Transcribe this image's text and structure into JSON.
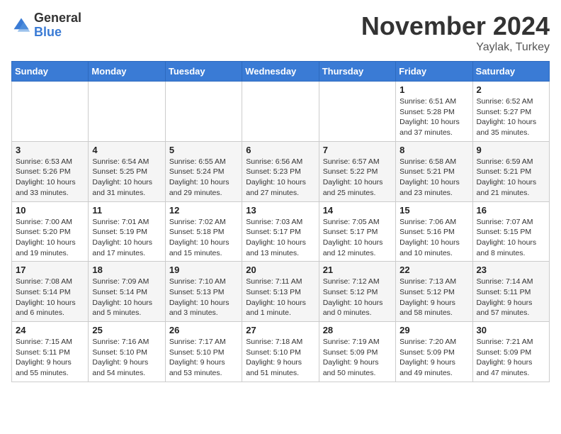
{
  "logo": {
    "general": "General",
    "blue": "Blue"
  },
  "title": "November 2024",
  "location": "Yaylak, Turkey",
  "weekdays": [
    "Sunday",
    "Monday",
    "Tuesday",
    "Wednesday",
    "Thursday",
    "Friday",
    "Saturday"
  ],
  "weeks": [
    [
      {
        "day": "",
        "info": ""
      },
      {
        "day": "",
        "info": ""
      },
      {
        "day": "",
        "info": ""
      },
      {
        "day": "",
        "info": ""
      },
      {
        "day": "",
        "info": ""
      },
      {
        "day": "1",
        "info": "Sunrise: 6:51 AM\nSunset: 5:28 PM\nDaylight: 10 hours and 37 minutes."
      },
      {
        "day": "2",
        "info": "Sunrise: 6:52 AM\nSunset: 5:27 PM\nDaylight: 10 hours and 35 minutes."
      }
    ],
    [
      {
        "day": "3",
        "info": "Sunrise: 6:53 AM\nSunset: 5:26 PM\nDaylight: 10 hours and 33 minutes."
      },
      {
        "day": "4",
        "info": "Sunrise: 6:54 AM\nSunset: 5:25 PM\nDaylight: 10 hours and 31 minutes."
      },
      {
        "day": "5",
        "info": "Sunrise: 6:55 AM\nSunset: 5:24 PM\nDaylight: 10 hours and 29 minutes."
      },
      {
        "day": "6",
        "info": "Sunrise: 6:56 AM\nSunset: 5:23 PM\nDaylight: 10 hours and 27 minutes."
      },
      {
        "day": "7",
        "info": "Sunrise: 6:57 AM\nSunset: 5:22 PM\nDaylight: 10 hours and 25 minutes."
      },
      {
        "day": "8",
        "info": "Sunrise: 6:58 AM\nSunset: 5:21 PM\nDaylight: 10 hours and 23 minutes."
      },
      {
        "day": "9",
        "info": "Sunrise: 6:59 AM\nSunset: 5:21 PM\nDaylight: 10 hours and 21 minutes."
      }
    ],
    [
      {
        "day": "10",
        "info": "Sunrise: 7:00 AM\nSunset: 5:20 PM\nDaylight: 10 hours and 19 minutes."
      },
      {
        "day": "11",
        "info": "Sunrise: 7:01 AM\nSunset: 5:19 PM\nDaylight: 10 hours and 17 minutes."
      },
      {
        "day": "12",
        "info": "Sunrise: 7:02 AM\nSunset: 5:18 PM\nDaylight: 10 hours and 15 minutes."
      },
      {
        "day": "13",
        "info": "Sunrise: 7:03 AM\nSunset: 5:17 PM\nDaylight: 10 hours and 13 minutes."
      },
      {
        "day": "14",
        "info": "Sunrise: 7:05 AM\nSunset: 5:17 PM\nDaylight: 10 hours and 12 minutes."
      },
      {
        "day": "15",
        "info": "Sunrise: 7:06 AM\nSunset: 5:16 PM\nDaylight: 10 hours and 10 minutes."
      },
      {
        "day": "16",
        "info": "Sunrise: 7:07 AM\nSunset: 5:15 PM\nDaylight: 10 hours and 8 minutes."
      }
    ],
    [
      {
        "day": "17",
        "info": "Sunrise: 7:08 AM\nSunset: 5:14 PM\nDaylight: 10 hours and 6 minutes."
      },
      {
        "day": "18",
        "info": "Sunrise: 7:09 AM\nSunset: 5:14 PM\nDaylight: 10 hours and 5 minutes."
      },
      {
        "day": "19",
        "info": "Sunrise: 7:10 AM\nSunset: 5:13 PM\nDaylight: 10 hours and 3 minutes."
      },
      {
        "day": "20",
        "info": "Sunrise: 7:11 AM\nSunset: 5:13 PM\nDaylight: 10 hours and 1 minute."
      },
      {
        "day": "21",
        "info": "Sunrise: 7:12 AM\nSunset: 5:12 PM\nDaylight: 10 hours and 0 minutes."
      },
      {
        "day": "22",
        "info": "Sunrise: 7:13 AM\nSunset: 5:12 PM\nDaylight: 9 hours and 58 minutes."
      },
      {
        "day": "23",
        "info": "Sunrise: 7:14 AM\nSunset: 5:11 PM\nDaylight: 9 hours and 57 minutes."
      }
    ],
    [
      {
        "day": "24",
        "info": "Sunrise: 7:15 AM\nSunset: 5:11 PM\nDaylight: 9 hours and 55 minutes."
      },
      {
        "day": "25",
        "info": "Sunrise: 7:16 AM\nSunset: 5:10 PM\nDaylight: 9 hours and 54 minutes."
      },
      {
        "day": "26",
        "info": "Sunrise: 7:17 AM\nSunset: 5:10 PM\nDaylight: 9 hours and 53 minutes."
      },
      {
        "day": "27",
        "info": "Sunrise: 7:18 AM\nSunset: 5:10 PM\nDaylight: 9 hours and 51 minutes."
      },
      {
        "day": "28",
        "info": "Sunrise: 7:19 AM\nSunset: 5:09 PM\nDaylight: 9 hours and 50 minutes."
      },
      {
        "day": "29",
        "info": "Sunrise: 7:20 AM\nSunset: 5:09 PM\nDaylight: 9 hours and 49 minutes."
      },
      {
        "day": "30",
        "info": "Sunrise: 7:21 AM\nSunset: 5:09 PM\nDaylight: 9 hours and 47 minutes."
      }
    ]
  ]
}
